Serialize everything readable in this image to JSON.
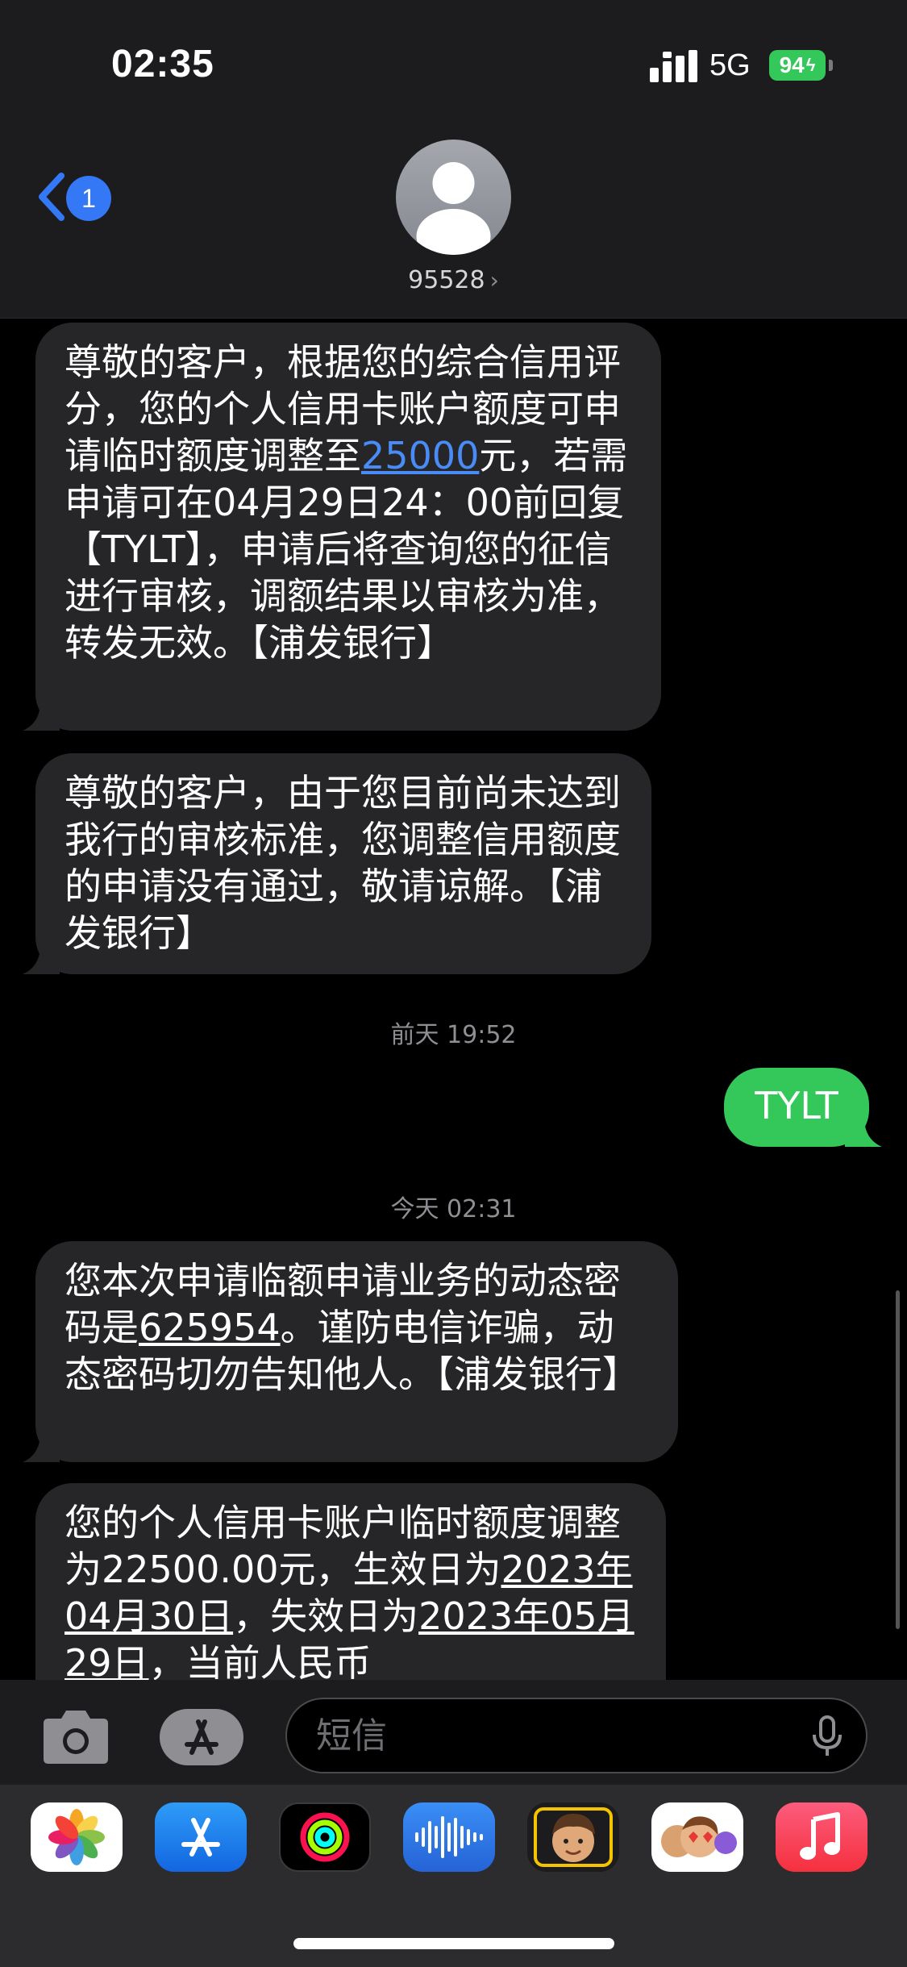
{
  "status_bar": {
    "time": "02:35",
    "network": "5G",
    "battery": "94"
  },
  "nav": {
    "back_badge": "1",
    "contact": "95528",
    "chevron": "›"
  },
  "messages": [
    {
      "type": "in",
      "segments": [
        {
          "text": "尊敬的客户，根据您的综合信用评分，您的个人信用卡账户额度可申请临时额度调整至"
        },
        {
          "text": "25000",
          "style": "link"
        },
        {
          "text": "元，若需申请可在04月29日24：00前回复【TYLT】，申请后将查询您的征信进行审核，调额结果以审核为准，转发无效。【浦发银行】"
        }
      ]
    },
    {
      "type": "in",
      "segments": [
        {
          "text": "尊敬的客户，由于您目前尚未达到我行的审核标准，您调整信用额度的申请没有通过，敬请谅解。【浦发银行】"
        }
      ]
    },
    {
      "type": "out",
      "segments": [
        {
          "text": "TYLT"
        }
      ]
    },
    {
      "type": "in",
      "segments": [
        {
          "text": "您本次申请临额申请业务的动态密码是"
        },
        {
          "text": "625954",
          "style": "underline"
        },
        {
          "text": "。谨防电信诈骗，动态密码切勿告知他人。【浦发银行】"
        }
      ]
    },
    {
      "type": "in",
      "segments": [
        {
          "text": "您的个人信用卡账户临时额度调整为22500.00元，生效日为"
        },
        {
          "text": "2023年04月30日",
          "style": "underline"
        },
        {
          "text": "，失效日为"
        },
        {
          "text": "2023年05月29日",
          "style": "underline"
        },
        {
          "text": "，当前人民币"
        }
      ]
    }
  ],
  "timestamps": [
    "前天 19:52",
    "今天 02:31"
  ],
  "composer": {
    "placeholder": "短信",
    "icons": [
      "camera-icon",
      "app-store-icon",
      "microphone-icon"
    ]
  },
  "app_drawer": {
    "apps": [
      "photos-icon",
      "app-store-icon",
      "activity-icon",
      "voice-memos-icon",
      "memoji-icon",
      "animoji-stickers-icon",
      "music-icon"
    ]
  },
  "colors": {
    "incoming_bubble": "#262628",
    "outgoing_bubble": "#34c759",
    "link": "#4a8cf7",
    "badge": "#3478f6"
  }
}
